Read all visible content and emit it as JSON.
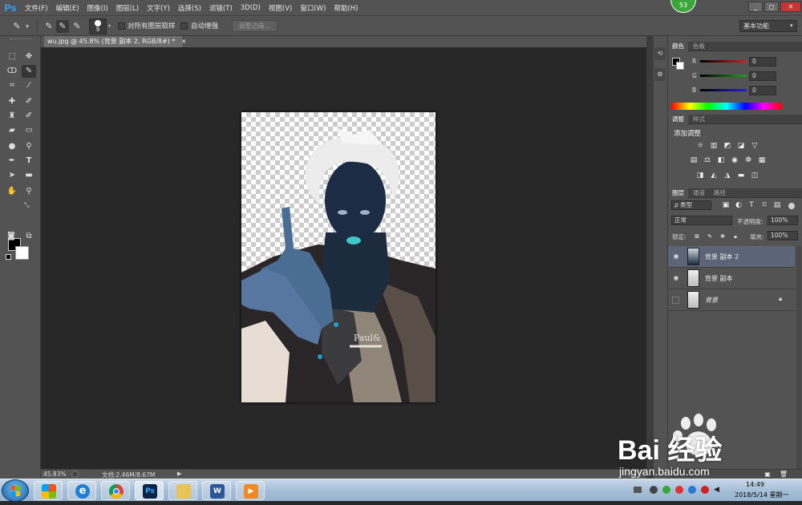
{
  "app": {
    "logo": "Ps",
    "badge": "53"
  },
  "menu": [
    "文件(F)",
    "编辑(E)",
    "图像(I)",
    "图层(L)",
    "文字(Y)",
    "选择(S)",
    "滤镜(T)",
    "3D(D)",
    "视图(V)",
    "窗口(W)",
    "帮助(H)"
  ],
  "window_controls": {
    "minimize": "_",
    "restore": "◻",
    "close": "✕"
  },
  "options": {
    "brush_size": "9",
    "sample_all_layers": "对所有图层取样",
    "auto_enhance": "自动增强",
    "refine_edge": "调整边缘...",
    "workspace": "基本功能"
  },
  "document": {
    "tab_title": "wu.jpg @ 45.8% (背景 副本 2, RGB/8#) *",
    "zoom": "45.83%",
    "doc_size": "文档:2.46M/8.67M"
  },
  "color_panel": {
    "tabs": [
      "颜色",
      "色板"
    ],
    "channels": [
      {
        "label": "R",
        "value": "0",
        "color": "#d42020"
      },
      {
        "label": "G",
        "value": "0",
        "color": "#1fa21f"
      },
      {
        "label": "B",
        "value": "0",
        "color": "#2020d8"
      }
    ]
  },
  "adjust_panel": {
    "tabs": [
      "调整",
      "样式"
    ],
    "title": "添加调整"
  },
  "layers_panel": {
    "tabs": [
      "图层",
      "通道",
      "路径"
    ],
    "filter_kind": "ρ 类型",
    "blend_mode": "正常",
    "opacity_label": "不透明度:",
    "opacity_value": "100%",
    "lock_label": "锁定:",
    "fill_label": "填充:",
    "fill_value": "100%",
    "layers": [
      {
        "name": "背景 副本 2",
        "visible": true,
        "selected": true,
        "locked": false
      },
      {
        "name": "背景 副本",
        "visible": true,
        "selected": false,
        "locked": false
      },
      {
        "name": "背景",
        "visible": false,
        "selected": false,
        "locked": true
      }
    ]
  },
  "taskbar": {
    "time": "14:49",
    "date": "2018/5/14 星期一"
  },
  "watermark": {
    "brand": "Bai 经验",
    "url": "jingyan.baidu.com"
  }
}
